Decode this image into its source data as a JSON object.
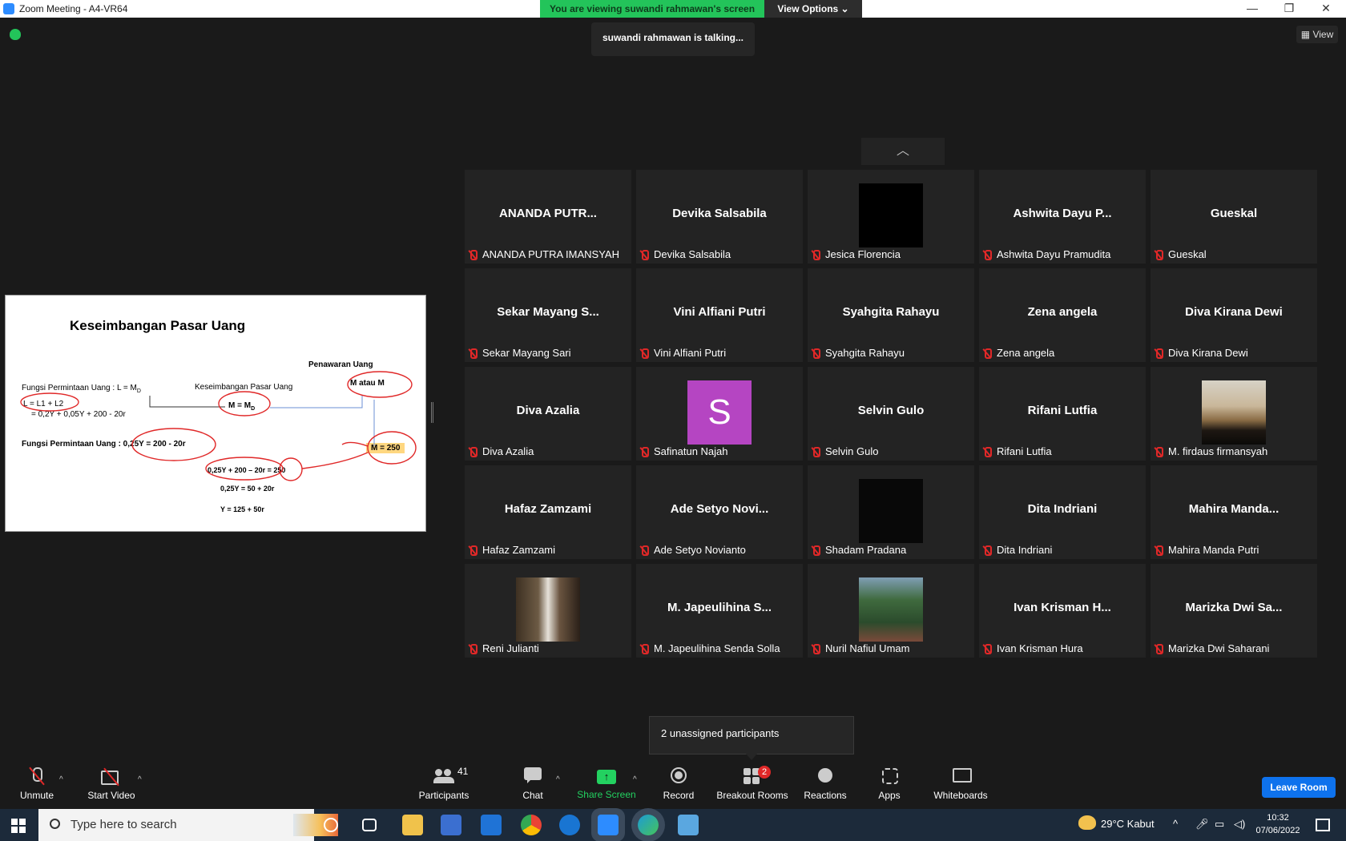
{
  "window": {
    "title": "Zoom Meeting - A4-VR64",
    "minimize": "—",
    "restore": "❐",
    "close": "✕"
  },
  "banner": {
    "viewing_text": "You are viewing suwandi rahmawan's screen",
    "view_options_label": "View Options ⌄"
  },
  "talking_indicator": "suwandi rahmawan is talking...",
  "view_button_label": "View",
  "shared_slide": {
    "title": "Keseimbangan Pasar Uang",
    "supply_label": "Penawaran Uang",
    "supply_box": "M atau M",
    "demand_function": "Fungsi Permintaan Uang :  L = M",
    "demand_subscript": "D",
    "equilibrium_label": "Keseimbangan Pasar Uang",
    "equilibrium_eq": "M  = M",
    "equilibrium_sub": "D",
    "l_eq": "L =  L1 + L2",
    "l_expansion": "= 0,2Y + 0,05Y + 200 - 20r",
    "demand_bold": "Fungsi Permintaan Uang : 0,25Y = 200 - 20r",
    "m_value": "M = 250",
    "step1": "0,25Y + 200 – 20r = 250",
    "step2": "0,25Y = 50 + 20r",
    "step3": "Y = 125 + 50r"
  },
  "pager_icon": "chevron-up-icon",
  "participants": [
    {
      "display": "ANANDA PUTR...",
      "name": "ANANDA PUTRA IMANSYAH",
      "video": "none"
    },
    {
      "display": "Devika Salsabila",
      "name": "Devika Salsabila",
      "video": "none"
    },
    {
      "display": "",
      "name": "Jesica Florencia",
      "video": "black"
    },
    {
      "display": "Ashwita Dayu P...",
      "name": "Ashwita Dayu Pramudita",
      "video": "none"
    },
    {
      "display": "Gueskal",
      "name": "Gueskal",
      "video": "none"
    },
    {
      "display": "Sekar  Mayang  S...",
      "name": "Sekar Mayang Sari",
      "video": "none"
    },
    {
      "display": "Vini Alfiani Putri",
      "name": "Vini Alfiani Putri",
      "video": "none"
    },
    {
      "display": "Syahgita Rahayu",
      "name": "Syahgita Rahayu",
      "video": "none"
    },
    {
      "display": "Zena angela",
      "name": "Zena angela",
      "video": "none"
    },
    {
      "display": "Diva Kirana Dewi",
      "name": "Diva Kirana Dewi",
      "video": "none"
    },
    {
      "display": "Diva Azalia",
      "name": "Diva Azalia",
      "video": "none"
    },
    {
      "display": "S",
      "name": "Safinatun Najah",
      "video": "avatar"
    },
    {
      "display": "Selvin Gulo",
      "name": "Selvin Gulo",
      "video": "none"
    },
    {
      "display": "Rifani Lutfia",
      "name": "Rifani Lutfia",
      "video": "none"
    },
    {
      "display": "",
      "name": "M. firdaus firmansyah",
      "video": "sunset"
    },
    {
      "display": "Hafaz Zamzami",
      "name": "Hafaz Zamzami",
      "video": "none"
    },
    {
      "display": "Ade Setyo Novi...",
      "name": "Ade Setyo Novianto",
      "video": "none"
    },
    {
      "display": "",
      "name": "Shadam Pradana",
      "video": "dark"
    },
    {
      "display": "Dita Indriani",
      "name": "Dita Indriani",
      "video": "none"
    },
    {
      "display": "Mahira  Manda...",
      "name": "Mahira Manda Putri",
      "video": "none"
    },
    {
      "display": "",
      "name": "Reni Julianti",
      "video": "person"
    },
    {
      "display": "M. Japeulihina S...",
      "name": "M. Japeulihina Senda Solla",
      "video": "none"
    },
    {
      "display": "",
      "name": "Nuril Nafiul Umam",
      "video": "forest"
    },
    {
      "display": "Ivan Krisman H...",
      "name": "Ivan Krisman Hura",
      "video": "none"
    },
    {
      "display": "Marizka Dwi Sa...",
      "name": "Marizka Dwi Saharani",
      "video": "none"
    }
  ],
  "unassigned_popup": "2 unassigned participants",
  "toolbar": {
    "unmute": "Unmute",
    "start_video": "Start Video",
    "participants": "Participants",
    "participants_count": "41",
    "chat": "Chat",
    "share_screen": "Share Screen",
    "record": "Record",
    "breakout_rooms": "Breakout Rooms",
    "breakout_badge": "2",
    "reactions": "Reactions",
    "apps": "Apps",
    "whiteboards": "Whiteboards",
    "leave": "Leave Room",
    "caret": "^"
  },
  "taskbar": {
    "search_placeholder": "Type here to search",
    "weather": "29°C  Kabut",
    "time": "10:32",
    "date": "07/06/2022"
  },
  "colors": {
    "accent_green": "#23c45a",
    "accent_blue": "#0e72ed",
    "muted_red": "#e02828",
    "tile_bg": "#232323"
  }
}
